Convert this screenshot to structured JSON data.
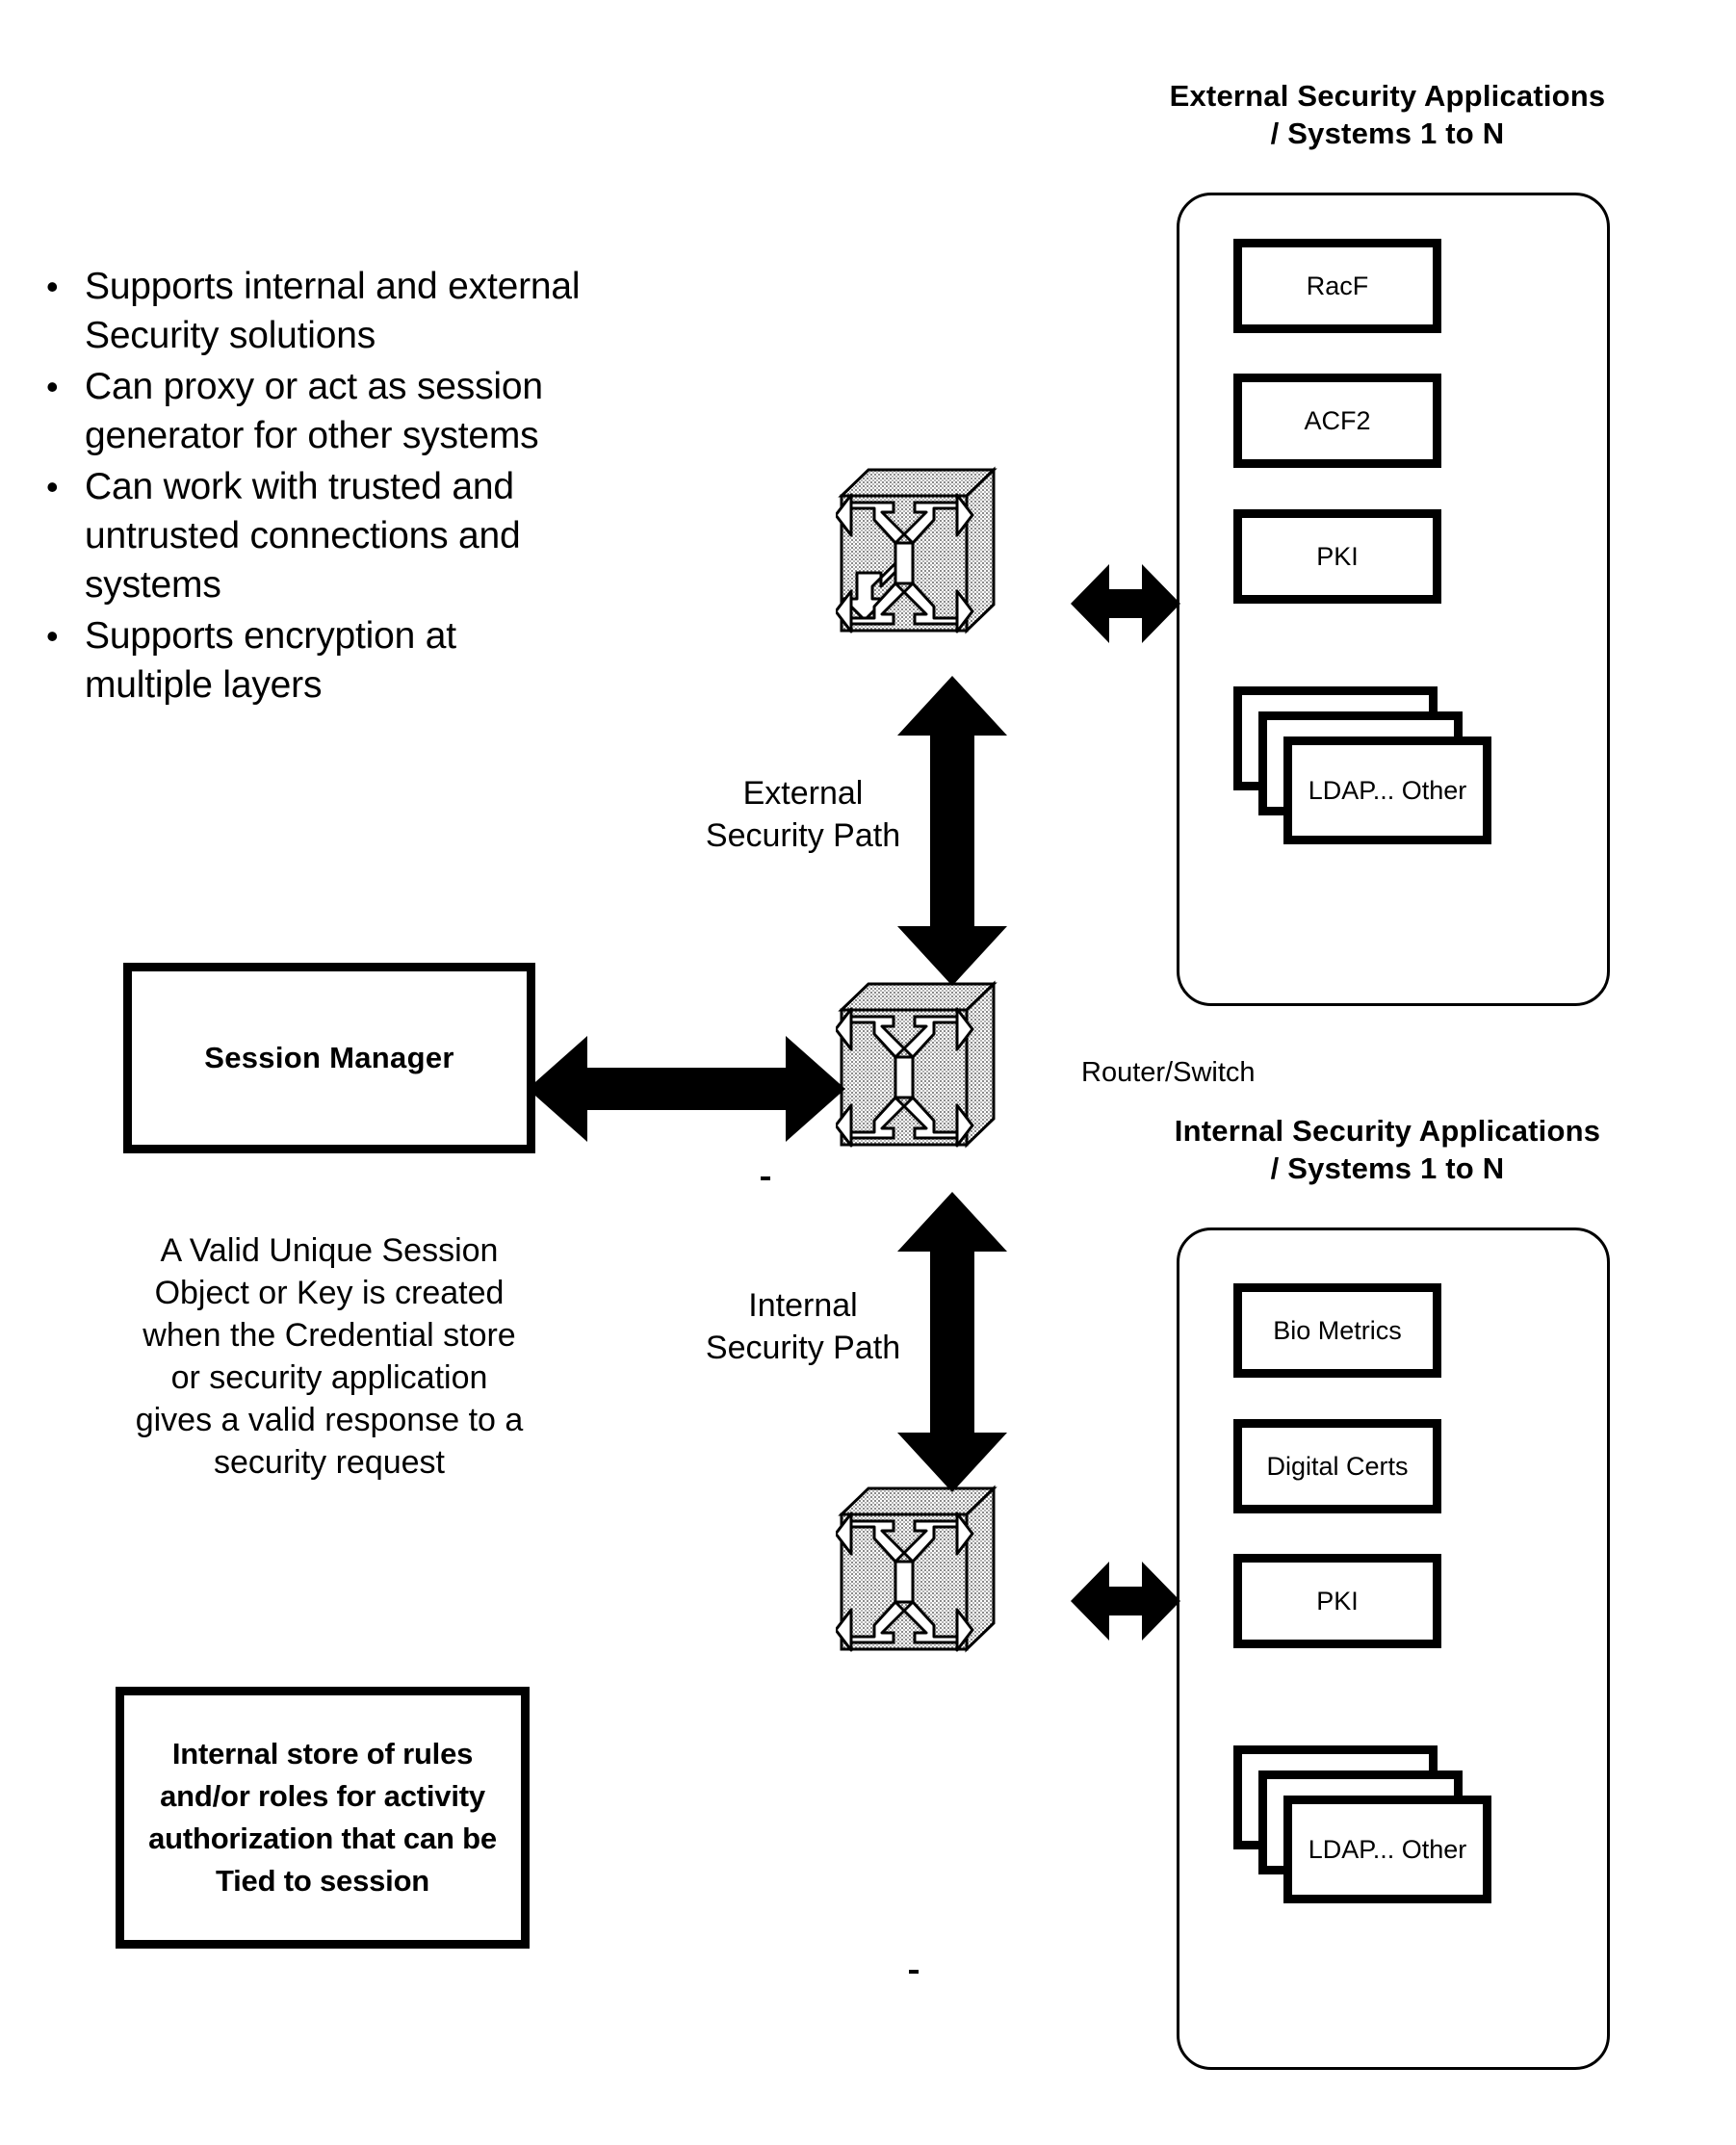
{
  "bullets": [
    "Supports internal and external Security solutions",
    "Can proxy or act as session generator for other systems",
    "Can work with trusted and untrusted connections and systems",
    "Supports encryption at multiple layers"
  ],
  "bullet_marker": "•",
  "session_manager": {
    "label": "Session Manager",
    "note": "A Valid Unique Session Object or Key is created when the Credential store or security application gives a valid response to a security request"
  },
  "rules_box": {
    "label": "Internal store of rules and/or roles for activity authorization that can be Tied to session"
  },
  "external_panel": {
    "heading": "External Security Applications / Systems 1 to N",
    "items": [
      "RacF",
      "ACF2",
      "PKI"
    ],
    "stack_label": "LDAP... Other"
  },
  "internal_panel": {
    "heading": "Internal Security Applications / Systems 1 to N",
    "items": [
      "Bio Metrics",
      "Digital Certs",
      "PKI"
    ],
    "stack_label": "LDAP... Other"
  },
  "paths": {
    "external": "External Security Path",
    "internal": "Internal Security Path"
  },
  "router": {
    "label": "Router/Switch",
    "icon": "router-switch-icon",
    "face_color": "#d9d9d9",
    "top_color": "#e6e6e6",
    "side_color": "#cccccc"
  },
  "colors": {
    "stroke": "#000000",
    "background": "#ffffff",
    "arrow": "#000000"
  }
}
